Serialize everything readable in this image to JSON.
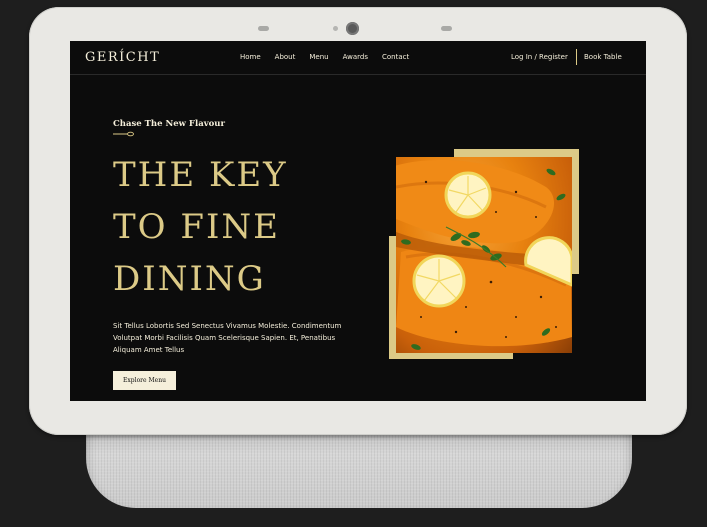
{
  "nav": {
    "logo": "GERÍCHT",
    "links": [
      "Home",
      "About",
      "Menu",
      "Awards",
      "Contact"
    ],
    "login": "Log In / Register",
    "book": "Book Table"
  },
  "hero": {
    "subtitle": "Chase The New Flavour",
    "headline": [
      "THE KEY",
      "TO FINE",
      "DINING"
    ],
    "description": "Sit Tellus Lobortis Sed Senectus Vivamus Molestie. Condimentum Volutpat Morbi Facilisis Quam Scelerisque Sapien. Et, Penatibus Aliquam Amet Tellus",
    "cta": "Explore Menu"
  },
  "colors": {
    "gold": "#dcca87",
    "cream": "#f5efdb",
    "black": "#0c0c0c"
  },
  "icons": [
    "spoon-icon"
  ]
}
